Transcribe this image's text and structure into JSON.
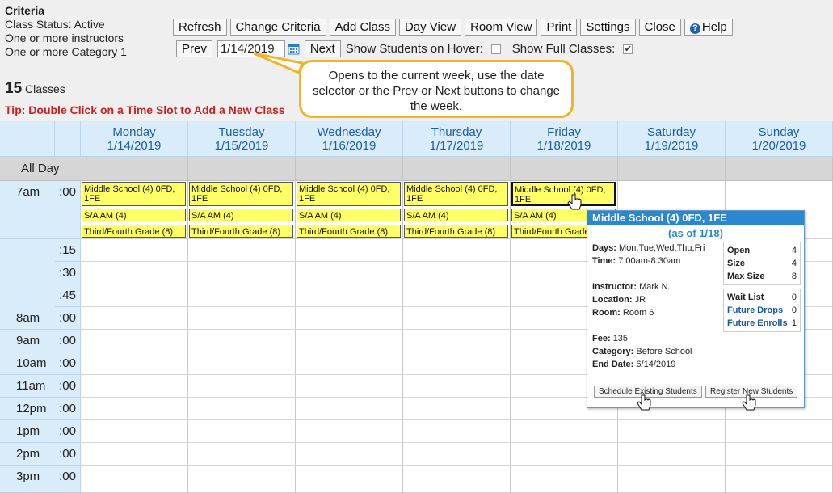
{
  "criteria": {
    "title": "Criteria",
    "lines": [
      "Class Status: Active",
      "One or more instructors",
      "One or more Category 1"
    ]
  },
  "toolbar": {
    "refresh": "Refresh",
    "change_criteria": "Change Criteria",
    "add_class": "Add Class",
    "day_view": "Day View",
    "room_view": "Room View",
    "print": "Print",
    "settings": "Settings",
    "close": "Close",
    "help": "Help"
  },
  "nav": {
    "prev": "Prev",
    "date": "1/14/2019",
    "next": "Next",
    "show_students_label": "Show Students on Hover:",
    "show_students_checked": false,
    "show_full_label": "Show Full Classes:",
    "show_full_checked": true
  },
  "summary": {
    "count": "15",
    "count_label": "Classes",
    "tip": "Tip: Double Click on a Time Slot to Add a New Class"
  },
  "callout": "Opens to the current week, use the date selector or the Prev or Next buttons to change the week.",
  "days": [
    {
      "name": "Monday",
      "date": "1/14/2019"
    },
    {
      "name": "Tuesday",
      "date": "1/15/2019"
    },
    {
      "name": "Wednesday",
      "date": "1/16/2019"
    },
    {
      "name": "Thursday",
      "date": "1/17/2019"
    },
    {
      "name": "Friday",
      "date": "1/18/2019"
    },
    {
      "name": "Saturday",
      "date": "1/19/2019"
    },
    {
      "name": "Sunday",
      "date": "1/20/2019"
    }
  ],
  "all_day_label": "All Day",
  "time_rows": [
    {
      "hour": "7am",
      "min": ":00"
    },
    {
      "hour": "",
      "min": ":15"
    },
    {
      "hour": "",
      "min": ":30"
    },
    {
      "hour": "",
      "min": ":45"
    },
    {
      "hour": "8am",
      "min": ":00"
    },
    {
      "hour": "9am",
      "min": ":00"
    },
    {
      "hour": "10am",
      "min": ":00"
    },
    {
      "hour": "11am",
      "min": ":00"
    },
    {
      "hour": "12pm",
      "min": ":00"
    },
    {
      "hour": "1pm",
      "min": ":00"
    },
    {
      "hour": "2pm",
      "min": ":00"
    },
    {
      "hour": "3pm",
      "min": ":00"
    }
  ],
  "classes": [
    "Middle School (4) 0FD, 1FE",
    "S/A AM (4)",
    "Third/Fourth Grade (8)"
  ],
  "class_days": 5,
  "popup": {
    "title": "Middle School (4) 0FD, 1FE",
    "as_of": "(as of 1/18)",
    "days_label": "Days:",
    "days": "Mon,Tue,Wed,Thu,Fri",
    "time_label": "Time:",
    "time": "7:00am-8:30am",
    "instructor_label": "Instructor:",
    "instructor": "Mark N.",
    "location_label": "Location:",
    "location": "JR",
    "room_label": "Room:",
    "room": "Room 6",
    "fee_label": "Fee:",
    "fee": "135",
    "category_label": "Category:",
    "category": "Before School",
    "end_date_label": "End Date:",
    "end_date": "6/14/2019",
    "open_label": "Open",
    "open": "4",
    "size_label": "Size",
    "size": "4",
    "max_label": "Max Size",
    "max": "8",
    "wait_label": "Wait List",
    "wait": "0",
    "drops_label": "Future Drops",
    "drops": "0",
    "enrolls_label": "Future Enrolls",
    "enrolls": "1",
    "schedule_btn": "Schedule Existing Students",
    "register_btn": "Register New Students"
  }
}
